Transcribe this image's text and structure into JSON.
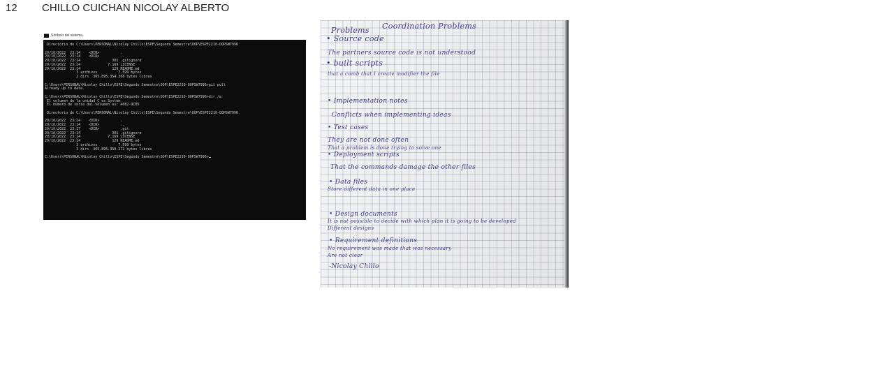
{
  "header": {
    "number": "12",
    "name": "CHILLO CUICHAN NICOLAY ALBERTO"
  },
  "terminal": {
    "title": "Símbolo del sistema",
    "lines": [
      " Directorio de C:\\Users\\PERSONAL\\Nicolay Chillo\\ESPE\\Segundo Semestre\\OOP\\ESPE2210-OOPSW7996",
      "",
      "29/10/2022  23:14    <DIR>          .",
      "29/10/2022  23:14    <DIR>          ..",
      "29/10/2022  23:14               301 .gitignore",
      "29/10/2022  23:14             7.169 LICENSE",
      "29/10/2022  23:14               129 README.md",
      "               3 archivos          7.599 bytes",
      "               2 dirs  305.895.354.368 bytes libres",
      "",
      "C:\\Users\\PERSONAL\\Nicolay Chillo\\ESPE\\Segundo Semestre\\OOP\\ESPE2210-OOPSW7996>git pull",
      "Already up to date.",
      "",
      "C:\\Users\\PERSONAL\\Nicolay Chillo\\ESPE\\Segundo Semestre\\OOP\\ESPE2210-OOPSW7996>dir /a",
      " El volumen de la unidad C es System",
      " El número de serie del volumen es: 4082-9C05",
      "",
      " Directorio de C:\\Users\\PERSONAL\\Nicolay Chillo\\ESPE\\Segundo Semestre\\OOP\\ESPE2210-OOPSW7996",
      "",
      "29/10/2022  23:14    <DIR>          .",
      "29/10/2022  23:14    <DIR>          ..",
      "29/10/2022  23:17    <DIR>          .git",
      "29/10/2022  23:14               301 .gitignore",
      "29/10/2022  23:14             7.169 LICENSE",
      "29/10/2022  23:14               129 README.md",
      "               3 archivos          7.599 bytes",
      "               3 dirs  305.895.350.272 bytes libres",
      "",
      "C:\\Users\\PERSONAL\\Nicolay Chillo\\ESPE\\Segundo Semestre\\OOP\\ESPE2210-OOPSW7996>"
    ]
  },
  "notebook": {
    "title": "Coordination Problems",
    "problems": "Problems",
    "lines": [
      "• Source code",
      "The partners source code is not understood",
      "• built scripts",
      "that a comb that I create modifier the file",
      "• Implementation notes",
      "Conflicts when implementing ideas",
      "• Test cases",
      "They are not done often",
      "That a problem is done trying to solve one",
      "• Deployment scripts",
      "That the commands damage the other files",
      "• Data files",
      "Store different data in one place",
      "• Design documents",
      "It is not possible to decide with which plan it is going to be developed",
      "Different designs",
      "• Requirement definitions",
      "No requirement was made that was necessary",
      "Are not clear",
      "-Nicolay Chillo"
    ]
  }
}
